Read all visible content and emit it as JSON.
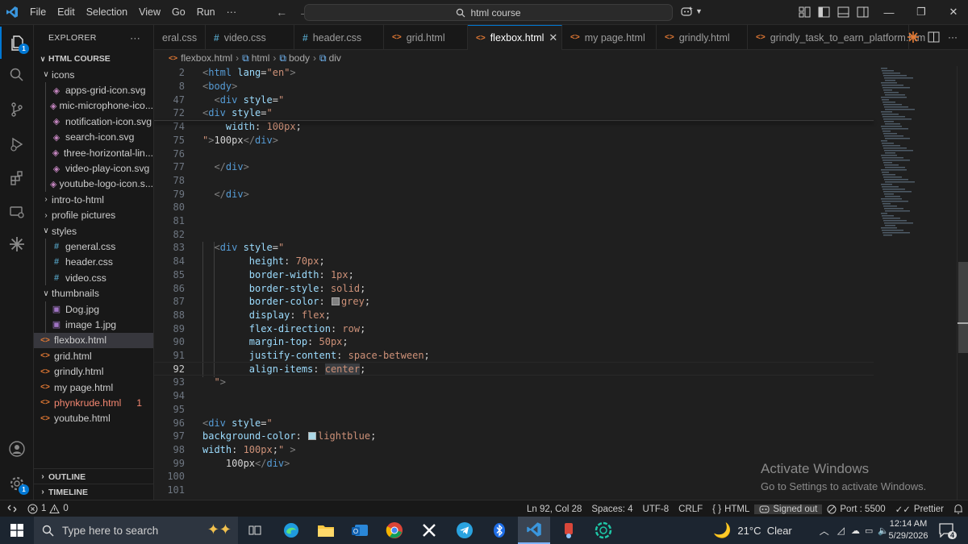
{
  "titlebar": {
    "menu": [
      "File",
      "Edit",
      "Selection",
      "View",
      "Go",
      "Run",
      "···"
    ],
    "search": "html course"
  },
  "activity": {
    "explorer_badge": "1",
    "settings_badge": "1"
  },
  "sidebar": {
    "title": "EXPLORER",
    "more": "···",
    "folder": "HTML COURSE",
    "items": [
      {
        "label": "icons",
        "type": "folder",
        "open": true,
        "depth": 1
      },
      {
        "label": "apps-grid-icon.svg",
        "type": "svg",
        "depth": 2
      },
      {
        "label": "mic-microphone-ico...",
        "type": "svg",
        "depth": 2
      },
      {
        "label": "notification-icon.svg",
        "type": "svg",
        "depth": 2
      },
      {
        "label": "search-icon.svg",
        "type": "svg",
        "depth": 2
      },
      {
        "label": "three-horizontal-lin...",
        "type": "svg",
        "depth": 2
      },
      {
        "label": "video-play-icon.svg",
        "type": "svg",
        "depth": 2
      },
      {
        "label": "youtube-logo-icon.s...",
        "type": "svg",
        "depth": 2
      },
      {
        "label": "intro-to-html",
        "type": "folder",
        "open": false,
        "depth": 1
      },
      {
        "label": "profile pictures",
        "type": "folder",
        "open": false,
        "depth": 1
      },
      {
        "label": "styles",
        "type": "folder",
        "open": true,
        "depth": 1
      },
      {
        "label": "general.css",
        "type": "css",
        "depth": 2
      },
      {
        "label": "header.css",
        "type": "css",
        "depth": 2
      },
      {
        "label": "video.css",
        "type": "css",
        "depth": 2
      },
      {
        "label": "thumbnails",
        "type": "folder",
        "open": true,
        "depth": 1
      },
      {
        "label": "Dog.jpg",
        "type": "img",
        "depth": 2
      },
      {
        "label": "image 1.jpg",
        "type": "img",
        "depth": 2
      },
      {
        "label": "flexbox.html",
        "type": "html",
        "depth": 1,
        "selected": true
      },
      {
        "label": "grid.html",
        "type": "html",
        "depth": 1
      },
      {
        "label": "grindly.html",
        "type": "html",
        "depth": 1
      },
      {
        "label": "my page.html",
        "type": "html",
        "depth": 1
      },
      {
        "label": "phynkrude.html",
        "type": "html",
        "depth": 1,
        "count": "1",
        "warn": true
      },
      {
        "label": "youtube.html",
        "type": "html",
        "depth": 1
      }
    ],
    "outline": "OUTLINE",
    "timeline": "TIMELINE"
  },
  "tabs": [
    {
      "label": "eral.css",
      "kind": "css",
      "width": 64
    },
    {
      "label": "video.css",
      "kind": "css",
      "width": 110
    },
    {
      "label": "header.css",
      "kind": "css",
      "width": 111
    },
    {
      "label": "grid.html",
      "kind": "html",
      "width": 104
    },
    {
      "label": "flexbox.html",
      "kind": "html",
      "width": 117,
      "active": true
    },
    {
      "label": "my page.html",
      "kind": "html",
      "width": 117
    },
    {
      "label": "grindly.html",
      "kind": "html",
      "width": 113
    },
    {
      "label": "grindly_task_to_earn_platform.htm",
      "kind": "html",
      "width": 200
    }
  ],
  "breadcrumb": [
    "flexbox.html",
    "html",
    "body",
    "div"
  ],
  "editor": {
    "lines": [
      {
        "n": "2",
        "tokens": [
          [
            "t-br",
            "<"
          ],
          [
            "t-tag",
            "html"
          ],
          [
            "t-txt",
            " "
          ],
          [
            "t-attr",
            "lang"
          ],
          [
            "t-txt",
            "="
          ],
          [
            "t-str",
            "\"en\""
          ],
          [
            "t-br",
            ">"
          ]
        ]
      },
      {
        "n": "8",
        "tokens": [
          [
            "t-br",
            "<"
          ],
          [
            "t-tag",
            "body"
          ],
          [
            "t-br",
            ">"
          ]
        ]
      },
      {
        "n": "47",
        "tokens": [
          [
            "t-txt",
            "  "
          ],
          [
            "t-br",
            "<"
          ],
          [
            "t-tag",
            "div"
          ],
          [
            "t-txt",
            " "
          ],
          [
            "t-attr",
            "style"
          ],
          [
            "t-txt",
            "="
          ],
          [
            "t-str",
            "\""
          ]
        ]
      },
      {
        "n": "72",
        "tokens": [
          [
            "t-br",
            "<"
          ],
          [
            "t-tag",
            "div"
          ],
          [
            "t-txt",
            " "
          ],
          [
            "t-attr",
            "style"
          ],
          [
            "t-txt",
            "="
          ],
          [
            "t-str",
            "\""
          ]
        ]
      },
      {
        "n": "74",
        "tokens": [
          [
            "t-txt",
            "    "
          ],
          [
            "t-prop",
            "width"
          ],
          [
            "t-txt",
            ": "
          ],
          [
            "t-val",
            "100px"
          ],
          [
            "t-txt",
            ";"
          ]
        ]
      },
      {
        "n": "75",
        "tokens": [
          [
            "t-str",
            "\""
          ],
          [
            "t-br",
            ">"
          ],
          [
            "t-txt",
            "100px"
          ],
          [
            "t-br",
            "</"
          ],
          [
            "t-tag",
            "div"
          ],
          [
            "t-br",
            ">"
          ]
        ]
      },
      {
        "n": "76",
        "tokens": []
      },
      {
        "n": "77",
        "tokens": [
          [
            "t-txt",
            "  "
          ],
          [
            "t-br",
            "</"
          ],
          [
            "t-tag",
            "div"
          ],
          [
            "t-br",
            ">"
          ]
        ]
      },
      {
        "n": "78",
        "tokens": []
      },
      {
        "n": "79",
        "tokens": [
          [
            "t-txt",
            "  "
          ],
          [
            "t-br",
            "</"
          ],
          [
            "t-tag",
            "div"
          ],
          [
            "t-br",
            ">"
          ]
        ]
      },
      {
        "n": "80",
        "tokens": []
      },
      {
        "n": "81",
        "tokens": []
      },
      {
        "n": "82",
        "tokens": []
      },
      {
        "n": "83",
        "tokens": [
          [
            "t-txt",
            "  "
          ],
          [
            "t-br",
            "<"
          ],
          [
            "t-tag",
            "div"
          ],
          [
            "t-txt",
            " "
          ],
          [
            "t-attr",
            "style"
          ],
          [
            "t-txt",
            "="
          ],
          [
            "t-str",
            "\""
          ]
        ]
      },
      {
        "n": "84",
        "tokens": [
          [
            "t-txt",
            "        "
          ],
          [
            "t-prop",
            "height"
          ],
          [
            "t-txt",
            ": "
          ],
          [
            "t-val",
            "70px"
          ],
          [
            "t-txt",
            ";"
          ]
        ]
      },
      {
        "n": "85",
        "tokens": [
          [
            "t-txt",
            "        "
          ],
          [
            "t-prop",
            "border-width"
          ],
          [
            "t-txt",
            ": "
          ],
          [
            "t-val",
            "1px"
          ],
          [
            "t-txt",
            ";"
          ]
        ]
      },
      {
        "n": "86",
        "tokens": [
          [
            "t-txt",
            "        "
          ],
          [
            "t-prop",
            "border-style"
          ],
          [
            "t-txt",
            ": "
          ],
          [
            "t-val",
            "solid"
          ],
          [
            "t-txt",
            ";"
          ]
        ]
      },
      {
        "n": "87",
        "tokens": [
          [
            "t-txt",
            "        "
          ],
          [
            "t-prop",
            "border-color"
          ],
          [
            "t-txt",
            ": "
          ],
          [
            "swatch",
            "grey"
          ],
          [
            "t-val",
            "grey"
          ],
          [
            "t-txt",
            ";"
          ]
        ]
      },
      {
        "n": "88",
        "tokens": [
          [
            "t-txt",
            "        "
          ],
          [
            "t-prop",
            "display"
          ],
          [
            "t-txt",
            ": "
          ],
          [
            "t-val",
            "flex"
          ],
          [
            "t-txt",
            ";"
          ]
        ]
      },
      {
        "n": "89",
        "tokens": [
          [
            "t-txt",
            "        "
          ],
          [
            "t-prop",
            "flex-direction"
          ],
          [
            "t-txt",
            ": "
          ],
          [
            "t-val",
            "row"
          ],
          [
            "t-txt",
            ";"
          ]
        ]
      },
      {
        "n": "90",
        "tokens": [
          [
            "t-txt",
            "        "
          ],
          [
            "t-prop",
            "margin-top"
          ],
          [
            "t-txt",
            ": "
          ],
          [
            "t-val",
            "50px"
          ],
          [
            "t-txt",
            ";"
          ]
        ]
      },
      {
        "n": "91",
        "tokens": [
          [
            "t-txt",
            "        "
          ],
          [
            "t-prop",
            "justify-content"
          ],
          [
            "t-txt",
            ": "
          ],
          [
            "t-val",
            "space-between"
          ],
          [
            "t-txt",
            ";"
          ]
        ]
      },
      {
        "n": "92",
        "current": true,
        "tokens": [
          [
            "t-txt",
            "        "
          ],
          [
            "t-prop",
            "align-items"
          ],
          [
            "t-txt",
            ": "
          ],
          [
            "t-val hl",
            "center"
          ],
          [
            "t-txt",
            ";"
          ]
        ]
      },
      {
        "n": "93",
        "tokens": [
          [
            "t-txt",
            "  "
          ],
          [
            "t-str",
            "\""
          ],
          [
            "t-br",
            ">"
          ]
        ]
      },
      {
        "n": "94",
        "tokens": []
      },
      {
        "n": "95",
        "tokens": []
      },
      {
        "n": "96",
        "tokens": [
          [
            "t-br",
            "<"
          ],
          [
            "t-tag",
            "div"
          ],
          [
            "t-txt",
            " "
          ],
          [
            "t-attr",
            "style"
          ],
          [
            "t-txt",
            "="
          ],
          [
            "t-str",
            "\""
          ]
        ]
      },
      {
        "n": "97",
        "tokens": [
          [
            "t-prop",
            "background-color"
          ],
          [
            "t-txt",
            ": "
          ],
          [
            "swatch",
            "lightblue"
          ],
          [
            "t-val",
            "lightblue"
          ],
          [
            "t-txt",
            ";"
          ]
        ]
      },
      {
        "n": "98",
        "tokens": [
          [
            "t-prop",
            "width"
          ],
          [
            "t-txt",
            ": "
          ],
          [
            "t-val",
            "100px"
          ],
          [
            "t-txt",
            ";"
          ],
          [
            "t-str",
            "\""
          ],
          [
            "t-txt",
            " "
          ],
          [
            "t-br",
            ">"
          ]
        ]
      },
      {
        "n": "99",
        "tokens": [
          [
            "t-txt",
            "    100px"
          ],
          [
            "t-br",
            "</"
          ],
          [
            "t-tag",
            "div"
          ],
          [
            "t-br",
            ">"
          ]
        ]
      },
      {
        "n": "100",
        "tokens": []
      },
      {
        "n": "101",
        "tokens": []
      }
    ]
  },
  "watermark": {
    "title": "Activate Windows",
    "subtitle": "Go to Settings to activate Windows."
  },
  "statusbar": {
    "errors": "1",
    "warnings": "0",
    "position": "Ln 92, Col 28",
    "spaces": "Spaces: 4",
    "encoding": "UTF-8",
    "eol": "CRLF",
    "language": "HTML",
    "account": "Signed out",
    "port": "Port : 5500",
    "formatter": "Prettier"
  },
  "taskbar": {
    "search_placeholder": "Type here to search",
    "weather": "21°C  Clear",
    "time": "12:14 AM",
    "date": "5/29/2026",
    "notification_count": "4"
  }
}
